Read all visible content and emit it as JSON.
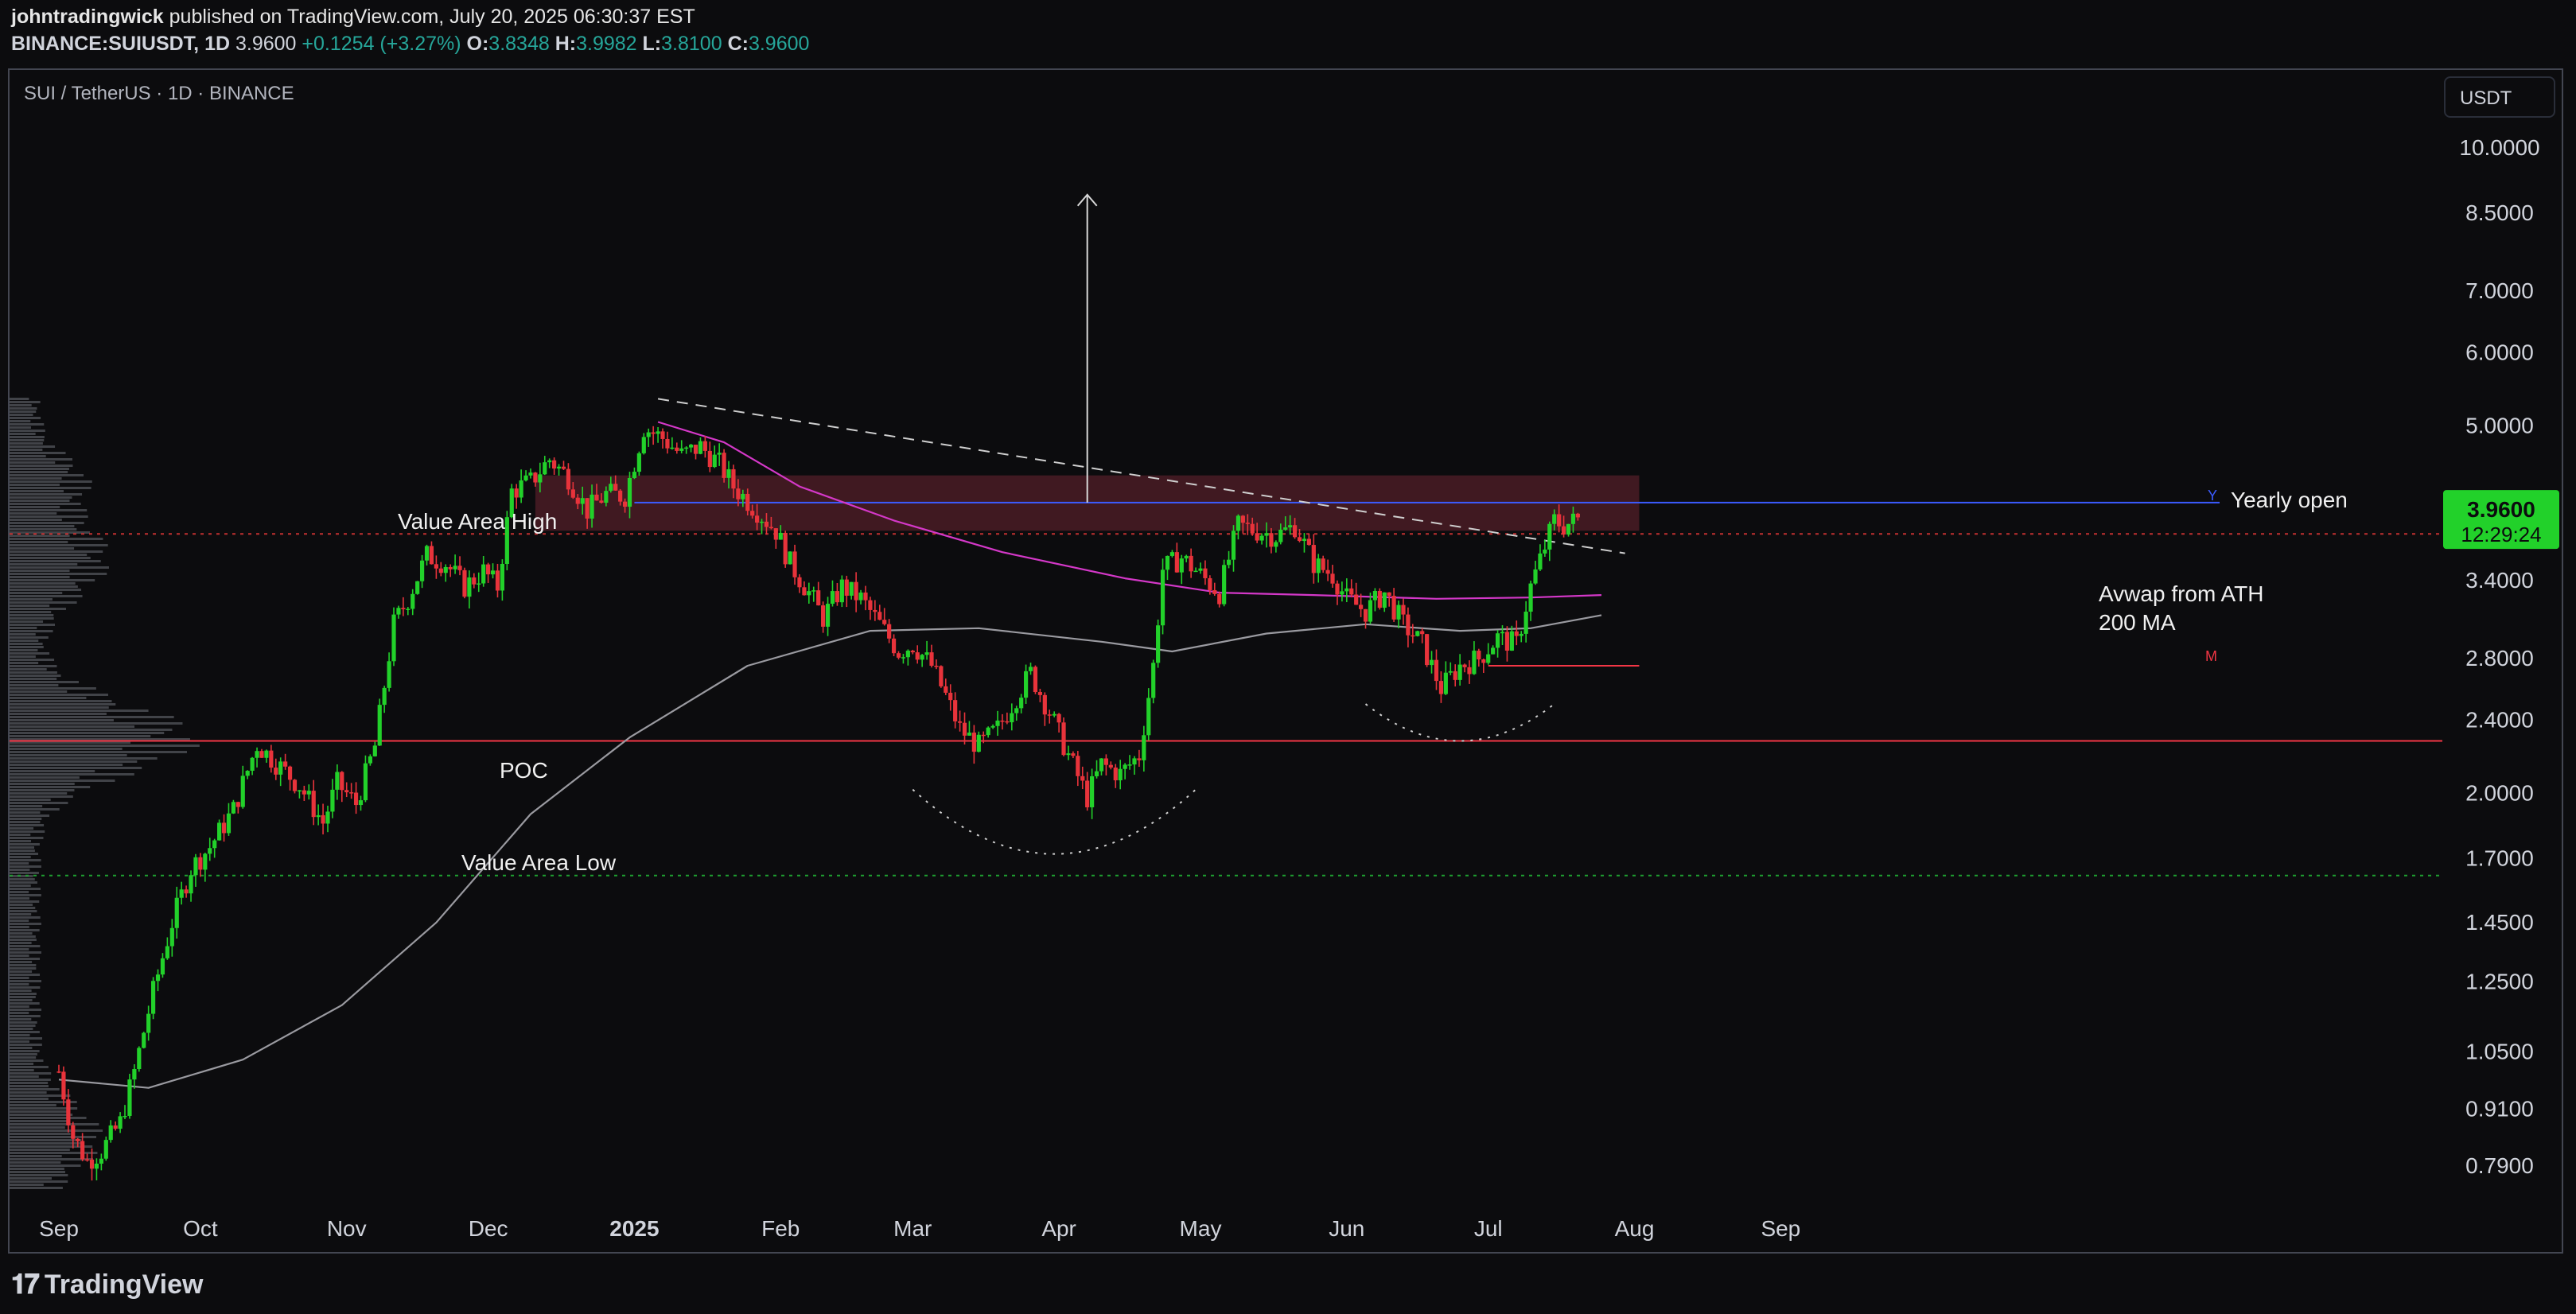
{
  "header": {
    "publisher": "johntradingwick",
    "published_text": " published on TradingView.com, July 20, 2025 06:30:37 EST",
    "symbol_line": "BINANCE:SUIUSDT, 1D",
    "last": "3.9600",
    "change": "+0.1254 (+3.27%)",
    "o_label": "O:",
    "o": "3.8348",
    "h_label": "H:",
    "h": "3.9982",
    "l_label": "L:",
    "l": "3.8100",
    "c_label": "C:",
    "c": "3.9600"
  },
  "symbol_title": "SUI / TetherUS · 1D · BINANCE",
  "currency_button": "USDT",
  "footer_logo": "TradingView",
  "colors": {
    "bull": "#22d12a",
    "bear": "#e8333b",
    "ma200": "#9a9aa0",
    "avwap": "#d438c8",
    "poc": "#f23645",
    "val": "#1e9e30",
    "vah": "#c23030",
    "zone": "#4a1c24",
    "yearly": "#3b5bff",
    "price_tag": "#22d12a"
  },
  "chart_data": {
    "type": "candlestick",
    "title": "SUI / TetherUS · 1D · BINANCE",
    "scale": "log",
    "y_ticks": [
      "10.0000",
      "8.5000",
      "7.0000",
      "6.0000",
      "5.0000",
      "3.4000",
      "2.8000",
      "2.4000",
      "2.0000",
      "1.7000",
      "1.4500",
      "1.2500",
      "1.0500",
      "0.9100",
      "0.7900"
    ],
    "x_ticks": [
      {
        "label": "Sep",
        "date": "2024-09-01",
        "bold": false
      },
      {
        "label": "Oct",
        "date": "2024-10-01",
        "bold": false
      },
      {
        "label": "Nov",
        "date": "2024-11-01",
        "bold": false
      },
      {
        "label": "Dec",
        "date": "2024-12-01",
        "bold": false
      },
      {
        "label": "2025",
        "date": "2025-01-01",
        "bold": true
      },
      {
        "label": "Feb",
        "date": "2025-02-01",
        "bold": false
      },
      {
        "label": "Mar",
        "date": "2025-03-01",
        "bold": false
      },
      {
        "label": "Apr",
        "date": "2025-04-01",
        "bold": false
      },
      {
        "label": "May",
        "date": "2025-05-01",
        "bold": false
      },
      {
        "label": "Jun",
        "date": "2025-06-01",
        "bold": false
      },
      {
        "label": "Jul",
        "date": "2025-07-01",
        "bold": false
      },
      {
        "label": "Aug",
        "date": "2025-08-01",
        "bold": false
      },
      {
        "label": "Sep",
        "date": "2025-09-01",
        "bold": false
      }
    ],
    "price_path": [
      [
        "2024-09-01",
        1.0
      ],
      [
        "2024-09-04",
        0.85
      ],
      [
        "2024-09-07",
        0.8
      ],
      [
        "2024-09-10",
        0.82
      ],
      [
        "2024-09-14",
        0.88
      ],
      [
        "2024-09-17",
        1.0
      ],
      [
        "2024-09-21",
        1.22
      ],
      [
        "2024-09-25",
        1.45
      ],
      [
        "2024-09-29",
        1.66
      ],
      [
        "2024-10-03",
        1.75
      ],
      [
        "2024-10-08",
        1.92
      ],
      [
        "2024-10-13",
        2.26
      ],
      [
        "2024-10-17",
        2.16
      ],
      [
        "2024-10-22",
        2.04
      ],
      [
        "2024-10-27",
        1.86
      ],
      [
        "2024-10-30",
        2.05
      ],
      [
        "2024-11-03",
        1.95
      ],
      [
        "2024-11-07",
        2.25
      ],
      [
        "2024-11-11",
        3.05
      ],
      [
        "2024-11-14",
        3.25
      ],
      [
        "2024-11-18",
        3.62
      ],
      [
        "2024-11-22",
        3.55
      ],
      [
        "2024-11-26",
        3.35
      ],
      [
        "2024-11-30",
        3.48
      ],
      [
        "2024-12-03",
        3.35
      ],
      [
        "2024-12-06",
        4.25
      ],
      [
        "2024-12-10",
        4.35
      ],
      [
        "2024-12-14",
        4.6
      ],
      [
        "2024-12-18",
        4.4
      ],
      [
        "2024-12-22",
        4.05
      ],
      [
        "2024-12-26",
        4.22
      ],
      [
        "2024-12-30",
        4.2
      ],
      [
        "2025-01-03",
        4.98
      ],
      [
        "2025-01-07",
        4.85
      ],
      [
        "2025-01-11",
        4.65
      ],
      [
        "2025-01-15",
        4.75
      ],
      [
        "2025-01-19",
        4.55
      ],
      [
        "2025-01-22",
        4.3
      ],
      [
        "2025-01-27",
        4.05
      ],
      [
        "2025-01-31",
        3.85
      ],
      [
        "2025-02-03",
        3.55
      ],
      [
        "2025-02-07",
        3.3
      ],
      [
        "2025-02-10",
        3.1
      ],
      [
        "2025-02-14",
        3.35
      ],
      [
        "2025-02-18",
        3.25
      ],
      [
        "2025-02-22",
        3.05
      ],
      [
        "2025-02-26",
        2.85
      ],
      [
        "2025-03-01",
        2.9
      ],
      [
        "2025-03-05",
        2.75
      ],
      [
        "2025-03-08",
        2.55
      ],
      [
        "2025-03-11",
        2.35
      ],
      [
        "2025-03-15",
        2.25
      ],
      [
        "2025-03-19",
        2.35
      ],
      [
        "2025-03-23",
        2.55
      ],
      [
        "2025-03-26",
        2.7
      ],
      [
        "2025-03-30",
        2.45
      ],
      [
        "2025-04-03",
        2.2
      ],
      [
        "2025-04-07",
        1.98
      ],
      [
        "2025-04-10",
        2.15
      ],
      [
        "2025-04-14",
        2.1
      ],
      [
        "2025-04-18",
        2.2
      ],
      [
        "2025-04-21",
        2.75
      ],
      [
        "2025-04-23",
        3.5
      ],
      [
        "2025-04-27",
        3.6
      ],
      [
        "2025-05-01",
        3.45
      ],
      [
        "2025-05-05",
        3.3
      ],
      [
        "2025-05-09",
        3.9
      ],
      [
        "2025-05-13",
        3.85
      ],
      [
        "2025-05-17",
        3.8
      ],
      [
        "2025-05-21",
        3.9
      ],
      [
        "2025-05-25",
        3.55
      ],
      [
        "2025-05-29",
        3.45
      ],
      [
        "2025-06-01",
        3.25
      ],
      [
        "2025-06-05",
        3.15
      ],
      [
        "2025-06-09",
        3.3
      ],
      [
        "2025-06-13",
        3.05
      ],
      [
        "2025-06-17",
        2.9
      ],
      [
        "2025-06-21",
        2.6
      ],
      [
        "2025-06-25",
        2.75
      ],
      [
        "2025-06-29",
        2.8
      ],
      [
        "2025-07-03",
        2.95
      ],
      [
        "2025-07-07",
        2.9
      ],
      [
        "2025-07-10",
        3.35
      ],
      [
        "2025-07-13",
        3.7
      ],
      [
        "2025-07-15",
        3.95
      ],
      [
        "2025-07-17",
        3.9
      ],
      [
        "2025-07-20",
        3.96
      ]
    ],
    "ma200_path": [
      [
        "2024-09-01",
        0.98
      ],
      [
        "2024-09-20",
        0.96
      ],
      [
        "2024-10-10",
        1.03
      ],
      [
        "2024-10-31",
        1.18
      ],
      [
        "2024-11-20",
        1.45
      ],
      [
        "2024-12-10",
        1.9
      ],
      [
        "2024-12-31",
        2.3
      ],
      [
        "2025-01-25",
        2.75
      ],
      [
        "2025-02-20",
        3.0
      ],
      [
        "2025-03-15",
        3.02
      ],
      [
        "2025-04-10",
        2.92
      ],
      [
        "2025-04-25",
        2.85
      ],
      [
        "2025-05-15",
        2.98
      ],
      [
        "2025-06-05",
        3.05
      ],
      [
        "2025-06-25",
        3.0
      ],
      [
        "2025-07-10",
        3.02
      ],
      [
        "2025-07-25",
        3.12
      ]
    ],
    "avwap_path": [
      [
        "2025-01-06",
        5.05
      ],
      [
        "2025-01-20",
        4.8
      ],
      [
        "2025-02-05",
        4.3
      ],
      [
        "2025-02-25",
        3.95
      ],
      [
        "2025-03-20",
        3.65
      ],
      [
        "2025-04-15",
        3.42
      ],
      [
        "2025-05-05",
        3.3
      ],
      [
        "2025-05-25",
        3.28
      ],
      [
        "2025-06-20",
        3.25
      ],
      [
        "2025-07-10",
        3.26
      ],
      [
        "2025-07-25",
        3.28
      ]
    ],
    "levels": [
      {
        "name": "Value Area High",
        "price": 3.82,
        "color": "#c23030",
        "dash": "4,6"
      },
      {
        "name": "POC",
        "price": 2.28,
        "color": "#f23645",
        "dash": ""
      },
      {
        "name": "Value Area Low",
        "price": 1.63,
        "color": "#1e9e30",
        "dash": "4,6"
      },
      {
        "name": "Yearly open",
        "price": 4.13,
        "color": "#3b5bff",
        "dash": ""
      }
    ],
    "zone": {
      "from": "2024-12-11",
      "to": "2025-08-02",
      "low": 3.85,
      "high": 4.42
    },
    "trendline": {
      "from": [
        "2025-01-06",
        5.35
      ],
      "to": [
        "2025-07-30",
        3.64
      ]
    },
    "m_line": {
      "from": "2025-07-01",
      "to": "2025-08-02",
      "price": 2.75
    },
    "arrow": {
      "date": "2025-04-07",
      "from": 4.13,
      "to": 8.9
    },
    "arcs": [
      {
        "from": "2025-03-01",
        "to": "2025-04-30",
        "bottom": 1.72,
        "top": 2.02
      },
      {
        "from": "2025-06-05",
        "to": "2025-07-15",
        "bottom": 2.28,
        "top": 2.5
      }
    ],
    "labels": {
      "value_area_high": "Value Area High",
      "poc": "POC",
      "value_area_low": "Value Area Low",
      "yearly_open": "Yearly open",
      "y_marker": "Y",
      "avwap": "Avwap from ATH",
      "ma200": "200 MA",
      "m_marker": "M"
    },
    "last_price": "3.9600",
    "countdown": "12:29:24"
  }
}
